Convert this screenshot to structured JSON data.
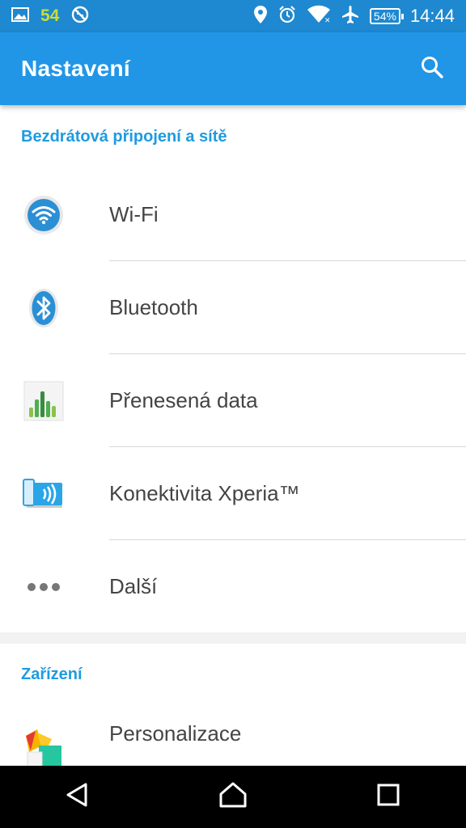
{
  "status_bar": {
    "notification_count": "54",
    "battery": "54%",
    "time": "14:44",
    "icons": [
      "image-icon",
      "location-icon",
      "alarm-icon",
      "wifi-icon",
      "airplane-icon",
      "battery-icon"
    ]
  },
  "app_bar": {
    "title": "Nastavení",
    "search_icon": "search-icon"
  },
  "sections": [
    {
      "header": "Bezdrátová připojení a sítě",
      "items": [
        {
          "label": "Wi-Fi",
          "icon": "wifi-icon"
        },
        {
          "label": "Bluetooth",
          "icon": "bluetooth-icon"
        },
        {
          "label": "Přenesená data",
          "icon": "data-usage-icon"
        },
        {
          "label": "Konektivita Xperia™",
          "icon": "xperia-connectivity-icon"
        },
        {
          "label": "Další",
          "icon": "more-icon"
        }
      ]
    },
    {
      "header": "Zařízení",
      "items": [
        {
          "label": "Personalizace",
          "icon": "personalization-icon"
        }
      ]
    }
  ],
  "colors": {
    "status_bar": "#1e88d0",
    "app_bar": "#2196e6",
    "accent": "#1e9be0",
    "notification_badge": "#c9dd3a"
  }
}
